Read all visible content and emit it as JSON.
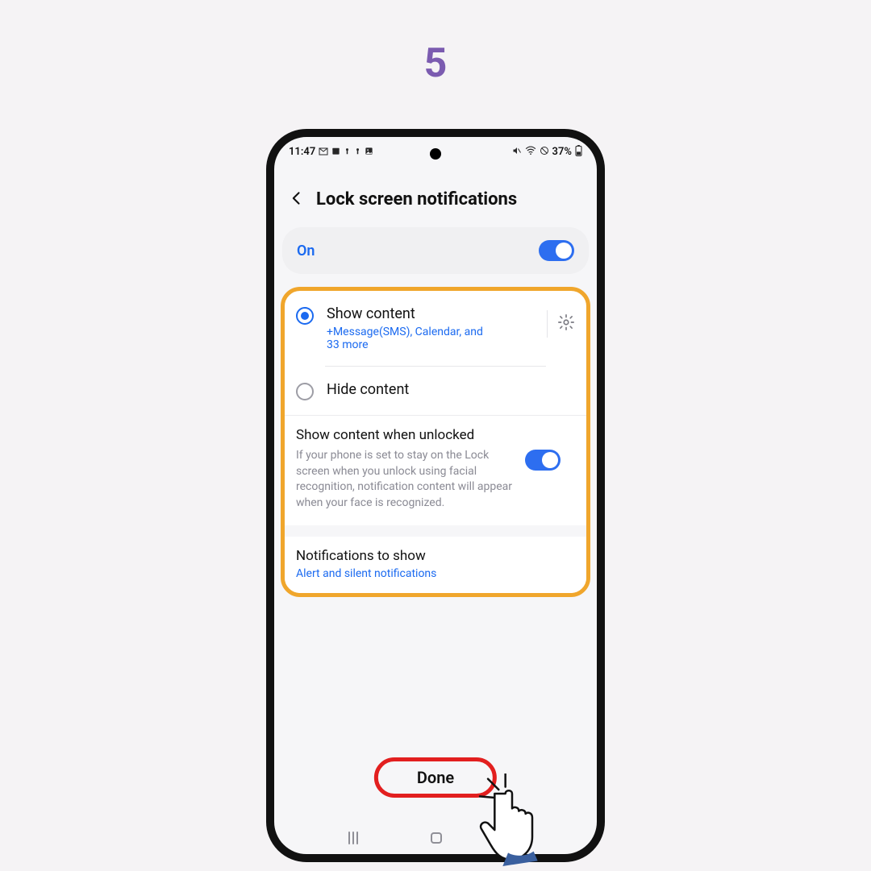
{
  "step_number": "5",
  "statusbar": {
    "time": "11:47",
    "battery": "37%"
  },
  "header": {
    "title": "Lock screen notifications"
  },
  "master_toggle": {
    "label": "On"
  },
  "options": {
    "show_content": {
      "title": "Show content",
      "subtitle": "+Message(SMS), Calendar, and 33 more"
    },
    "hide_content": {
      "title": "Hide content"
    }
  },
  "unlocked": {
    "title": "Show content when unlocked",
    "description": "If your phone is set to stay on the Lock screen when you unlock using facial recognition, notification content will appear when your face is recognized."
  },
  "notifications_to_show": {
    "title": "Notifications to show",
    "value": "Alert and silent notifications"
  },
  "done_label": "Done"
}
